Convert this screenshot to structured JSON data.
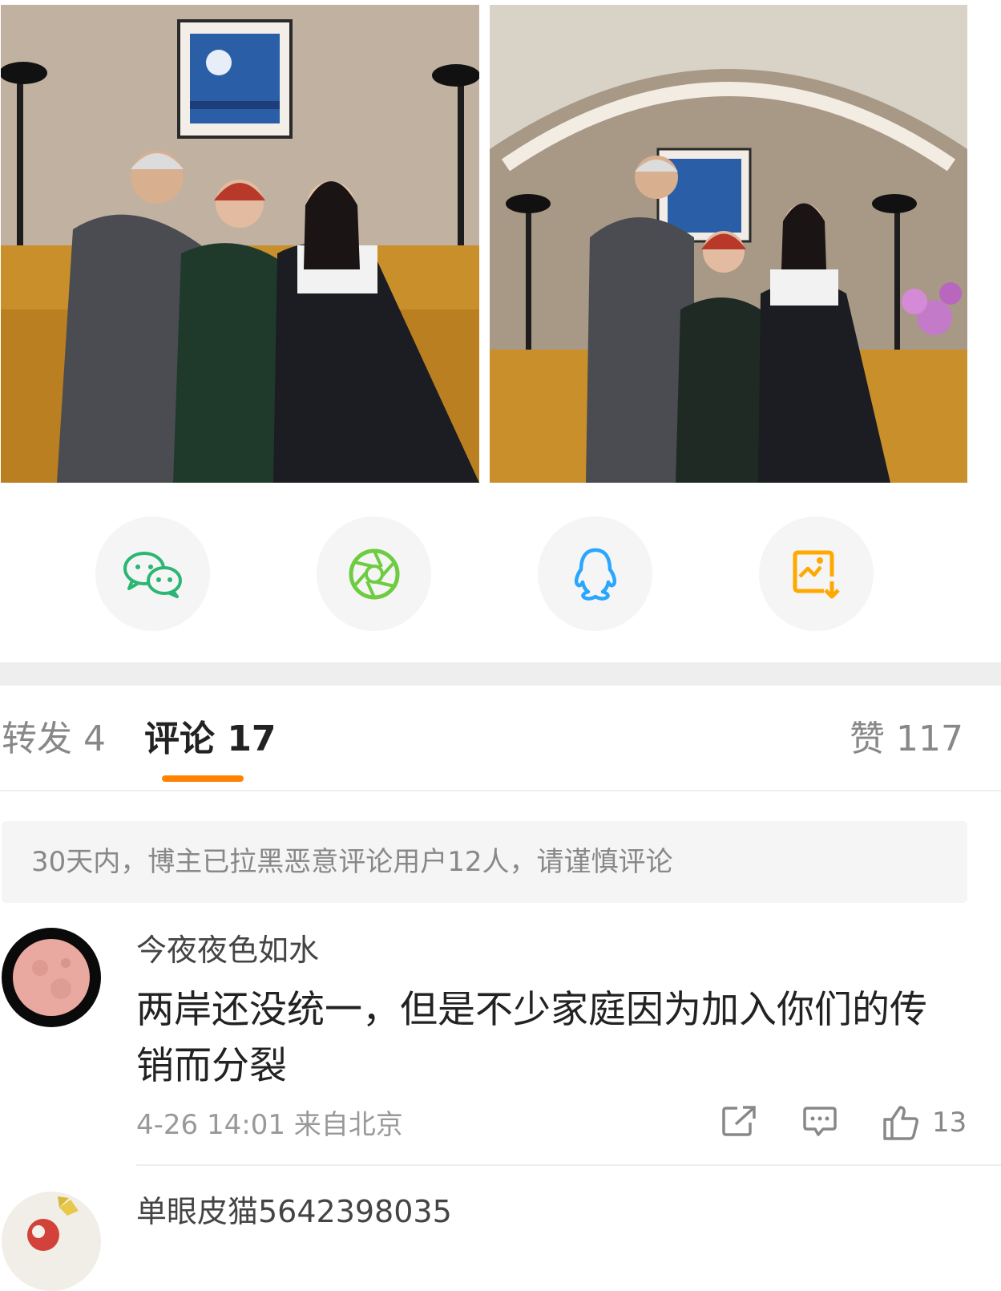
{
  "photos": [
    {
      "name": "group photo seated on sofa"
    },
    {
      "name": "group photo standing under arch"
    }
  ],
  "share": {
    "items": [
      {
        "icon": "wechat-icon",
        "color": "#2bb673"
      },
      {
        "icon": "moments-icon",
        "color": "#6dcc3f"
      },
      {
        "icon": "qq-icon",
        "color": "#2aa6ff"
      },
      {
        "icon": "save-image-icon",
        "color": "#ffa800"
      }
    ]
  },
  "tabs": {
    "repost": "转发 4",
    "comments": "评论 17",
    "likes": "赞 117",
    "active_color": "#ff8200"
  },
  "notice": "30天内，博主已拉黑恶意评论用户12人，请谨慎评论",
  "comments": [
    {
      "username": "今夜夜色如水",
      "text": "两岸还没统一，但是不少家庭因为加入你们的传销而分裂",
      "meta": "4-26 14:01 来自北京",
      "likes": "13"
    },
    {
      "username": "单眼皮猫5642398035"
    }
  ]
}
